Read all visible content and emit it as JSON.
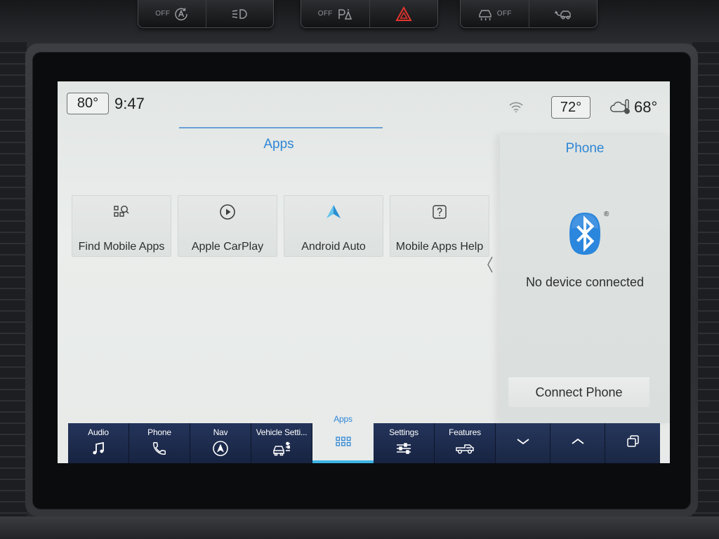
{
  "colors": {
    "accent_blue": "#2f86d6",
    "nav_bar": "#1e2c4a",
    "active_tab_underline": "#3db4e6",
    "hazard_red": "#e2352d",
    "bluetooth_blue": "#2b86dd",
    "android_auto_light": "#66c4ec",
    "android_auto_dark": "#2a8ed2"
  },
  "hardware_buttons": [
    {
      "icon": "auto-start-stop-icon",
      "label": "OFF"
    },
    {
      "icon": "parking-lights-icon"
    },
    {
      "icon": "park-assist-icon",
      "label": "OFF"
    },
    {
      "icon": "hazard-icon"
    },
    {
      "icon": "traction-control-icon",
      "label": "OFF"
    },
    {
      "icon": "trailer-assist-icon"
    }
  ],
  "status_bar": {
    "driver_temp": "80°",
    "time": "9:47",
    "wifi_icon": "wifi-icon",
    "passenger_temp": "72°",
    "weather_icon": "cloud-thermometer-icon",
    "outside_temp": "68°"
  },
  "apps": {
    "title": "Apps",
    "tiles": [
      {
        "label": "Find Mobile Apps",
        "icon": "find-apps-icon"
      },
      {
        "label": "Apple CarPlay",
        "icon": "carplay-icon"
      },
      {
        "label": "Android Auto",
        "icon": "android-auto-icon"
      },
      {
        "label": "Mobile Apps Help",
        "icon": "help-icon"
      }
    ],
    "panel_toggle_icon": "chevron-left-icon"
  },
  "phone_panel": {
    "title": "Phone",
    "logo_icon": "bluetooth-icon",
    "trademark": "®",
    "status": "No device connected",
    "connect_button": "Connect Phone"
  },
  "nav_bar": {
    "items": [
      {
        "label": "Audio",
        "icon": "music-note-icon"
      },
      {
        "label": "Phone",
        "icon": "phone-icon"
      },
      {
        "label": "Nav",
        "icon": "navigation-icon"
      },
      {
        "label": "Vehicle Setti...",
        "icon": "vehicle-settings-icon"
      },
      {
        "label": "Apps",
        "icon": "apps-grid-icon",
        "active": true
      },
      {
        "label": "Settings",
        "icon": "sliders-icon"
      },
      {
        "label": "Features",
        "icon": "truck-icon"
      }
    ],
    "controls": [
      {
        "icon": "chevron-down-icon"
      },
      {
        "icon": "chevron-up-icon"
      },
      {
        "icon": "multi-window-icon"
      }
    ]
  }
}
